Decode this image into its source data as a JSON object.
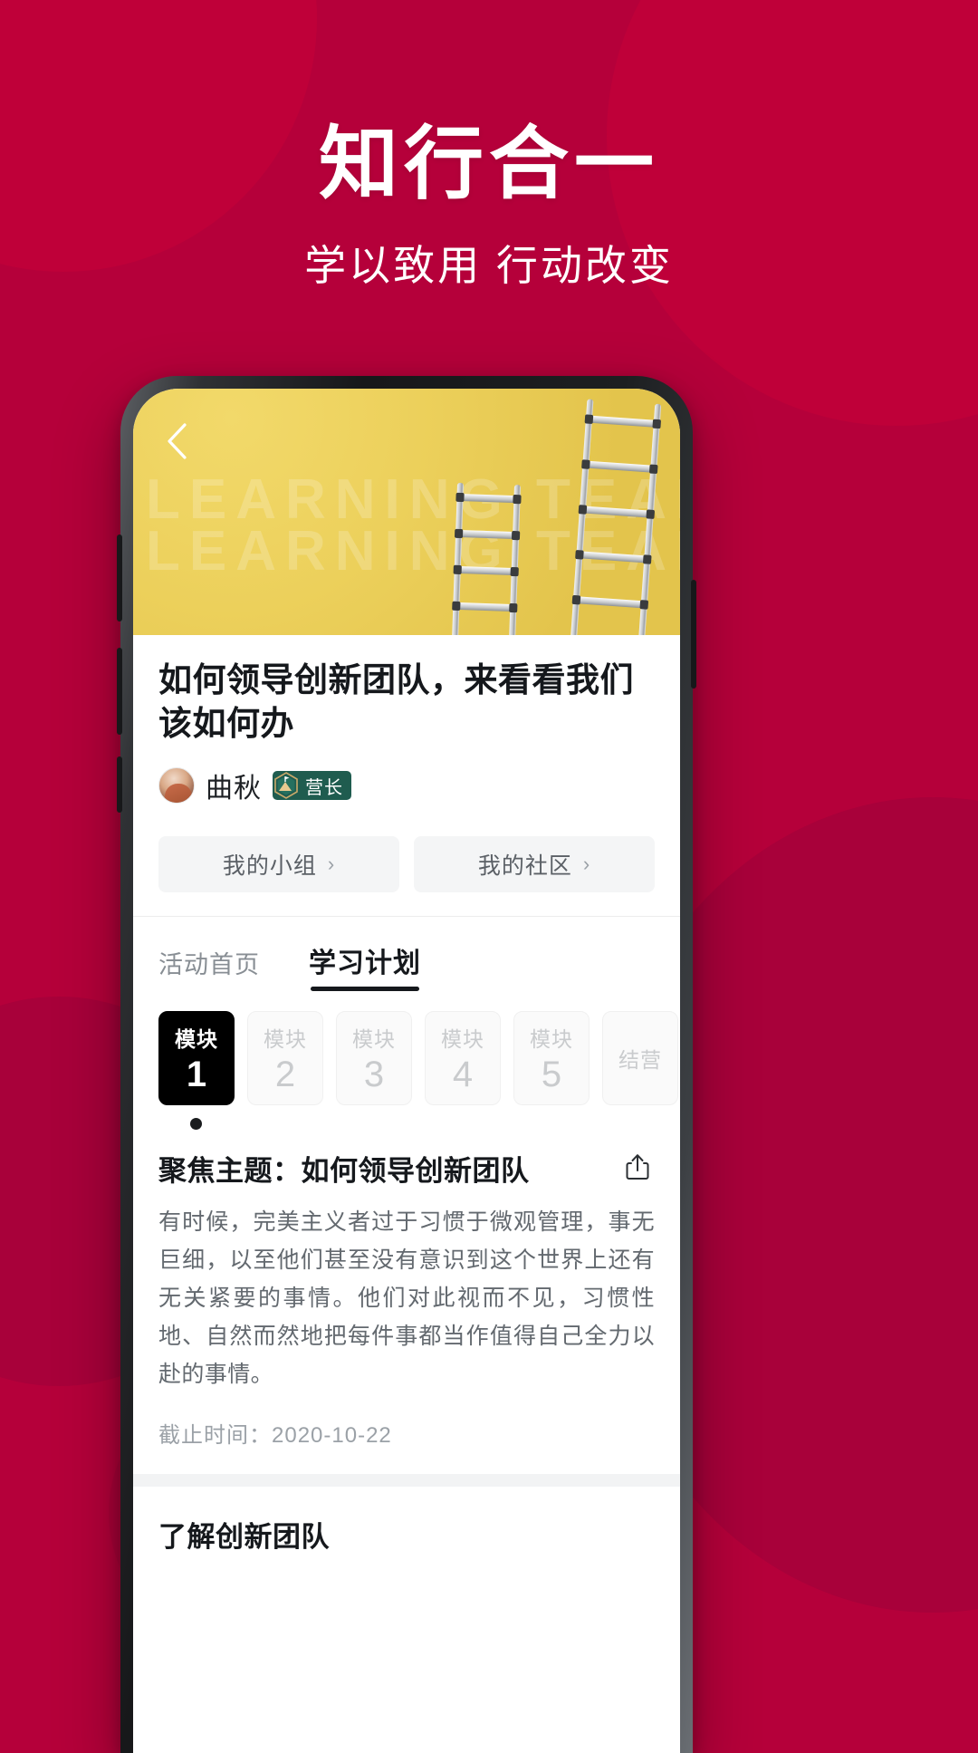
{
  "theme": {
    "brand_red": "#b5003a",
    "accent_black": "#000000",
    "badge_green": "#1f5c4f",
    "hero_yellow": "#ecd05b"
  },
  "promo": {
    "title": "知行合一",
    "subtitle": "学以致用 行动改变"
  },
  "hero": {
    "watermark_line1": "LEARNING TEAM",
    "watermark_line2": "LEARNING TEAM",
    "back_icon": "chevron-left-icon"
  },
  "article": {
    "title": "如何领导创新团队，来看看我们该如何办",
    "author_name": "曲秋",
    "author_badge": "营长",
    "avatar_icon": "user-avatar"
  },
  "group_buttons": [
    {
      "label": "我的小组",
      "chevron": "›"
    },
    {
      "label": "我的社区",
      "chevron": "›"
    }
  ],
  "tabs": [
    {
      "label": "活动首页",
      "active": false
    },
    {
      "label": "学习计划",
      "active": true
    }
  ],
  "modules": [
    {
      "word": "模块",
      "num": "1",
      "active": true
    },
    {
      "word": "模块",
      "num": "2",
      "active": false
    },
    {
      "word": "模块",
      "num": "3",
      "active": false
    },
    {
      "word": "模块",
      "num": "4",
      "active": false
    },
    {
      "word": "模块",
      "num": "5",
      "active": false
    },
    {
      "word": "结营",
      "num": "",
      "active": false
    }
  ],
  "lesson": {
    "title": "聚焦主题：如何领导创新团队",
    "share_icon": "share-icon",
    "body": "有时候，完美主义者过于习惯于微观管理，事无巨细，以至他们甚至没有意识到这个世界上还有无关紧要的事情。他们对此视而不见，习惯性地、自然而然地把每件事都当作值得自己全力以赴的事情。",
    "deadline": "截止时间：2020-10-22"
  },
  "next_section": {
    "title": "了解创新团队"
  }
}
